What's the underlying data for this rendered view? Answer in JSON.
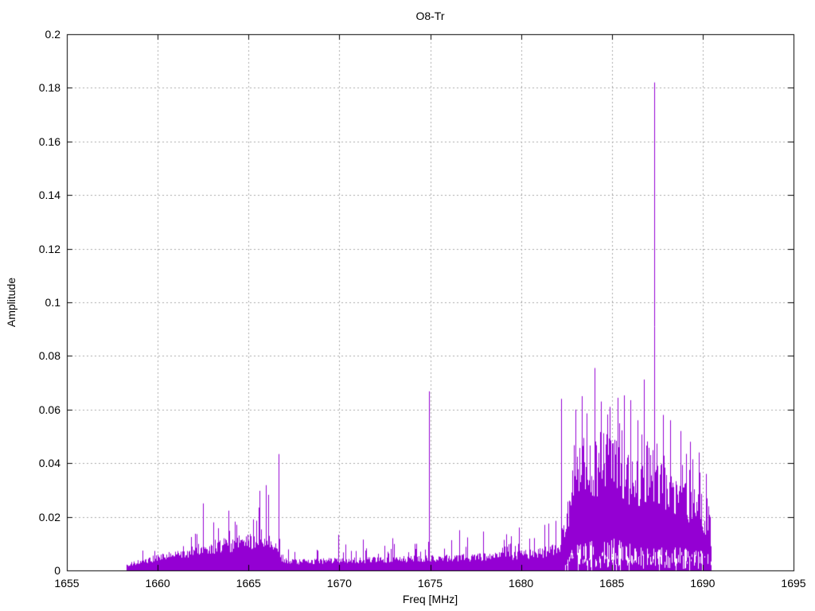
{
  "page": {
    "background": "#ffffff",
    "text_color": "#000000"
  },
  "chart_data": {
    "type": "line",
    "title": "O8-Tr",
    "xlabel": "Freq [MHz]",
    "ylabel": "Amplitude",
    "xlim": [
      1655,
      1695
    ],
    "ylim": [
      0,
      0.2
    ],
    "grid": true,
    "legend": "none",
    "series_name": "spectrum",
    "series_color": "#9400d3",
    "grid_color": "#a8a8a8",
    "axis_color": "#000000",
    "x_ticks": [
      {
        "v": 1655,
        "label": "1655"
      },
      {
        "v": 1660,
        "label": "1660"
      },
      {
        "v": 1665,
        "label": "1665"
      },
      {
        "v": 1670,
        "label": "1670"
      },
      {
        "v": 1675,
        "label": "1675"
      },
      {
        "v": 1680,
        "label": "1680"
      },
      {
        "v": 1685,
        "label": "1685"
      },
      {
        "v": 1690,
        "label": "1690"
      },
      {
        "v": 1695,
        "label": "1695"
      }
    ],
    "y_ticks": [
      {
        "v": 0,
        "label": "0"
      },
      {
        "v": 0.02,
        "label": "0.02"
      },
      {
        "v": 0.04,
        "label": "0.04"
      },
      {
        "v": 0.06,
        "label": "0.06"
      },
      {
        "v": 0.08,
        "label": "0.08"
      },
      {
        "v": 0.1,
        "label": "0.1"
      },
      {
        "v": 0.12,
        "label": "0.12"
      },
      {
        "v": 0.14,
        "label": "0.14"
      },
      {
        "v": 0.16,
        "label": "0.16"
      },
      {
        "v": 0.18,
        "label": "0.18"
      },
      {
        "v": 0.2,
        "label": "0.2"
      }
    ],
    "data_range": [
      1658.3,
      1690.45
    ],
    "envelope": {
      "dense_top": [
        [
          1658.3,
          0.0025
        ],
        [
          1659,
          0.004
        ],
        [
          1660,
          0.006
        ],
        [
          1661,
          0.007
        ],
        [
          1662,
          0.009
        ],
        [
          1663,
          0.011
        ],
        [
          1664,
          0.012
        ],
        [
          1665,
          0.013
        ],
        [
          1665.8,
          0.015
        ],
        [
          1666.3,
          0.013
        ],
        [
          1666.8,
          0.006
        ],
        [
          1667.3,
          0.004
        ],
        [
          1670,
          0.0045
        ],
        [
          1673,
          0.005
        ],
        [
          1675,
          0.0055
        ],
        [
          1677,
          0.006
        ],
        [
          1679,
          0.0065
        ],
        [
          1681,
          0.008
        ],
        [
          1682,
          0.01
        ],
        [
          1682.4,
          0.018
        ],
        [
          1682.7,
          0.035
        ],
        [
          1683.2,
          0.046
        ],
        [
          1684,
          0.05
        ],
        [
          1685,
          0.048
        ],
        [
          1686,
          0.044
        ],
        [
          1687,
          0.042
        ],
        [
          1687.6,
          0.04
        ],
        [
          1688.3,
          0.036
        ],
        [
          1689,
          0.032
        ],
        [
          1689.7,
          0.028
        ],
        [
          1690.1,
          0.024
        ],
        [
          1690.45,
          0.016
        ]
      ],
      "peak_top": [
        [
          1658.3,
          0.005
        ],
        [
          1659,
          0.009
        ],
        [
          1660,
          0.0115
        ],
        [
          1661,
          0.012
        ],
        [
          1662,
          0.014
        ],
        [
          1663,
          0.018
        ],
        [
          1663.9,
          0.022
        ],
        [
          1664.5,
          0.018
        ],
        [
          1665.2,
          0.02
        ],
        [
          1665.9,
          0.03
        ],
        [
          1666.3,
          0.026
        ],
        [
          1666.8,
          0.012
        ],
        [
          1667.3,
          0.009
        ],
        [
          1670,
          0.01
        ],
        [
          1672,
          0.01
        ],
        [
          1674,
          0.011
        ],
        [
          1675.5,
          0.012
        ],
        [
          1677,
          0.013
        ],
        [
          1678.5,
          0.013
        ],
        [
          1680,
          0.015
        ],
        [
          1681,
          0.016
        ],
        [
          1681.9,
          0.02
        ],
        [
          1682.4,
          0.03
        ],
        [
          1682.7,
          0.05
        ],
        [
          1683.2,
          0.058
        ],
        [
          1684,
          0.062
        ],
        [
          1685,
          0.06
        ],
        [
          1686,
          0.056
        ],
        [
          1687,
          0.054
        ],
        [
          1687.6,
          0.052
        ],
        [
          1688.3,
          0.048
        ],
        [
          1689,
          0.044
        ],
        [
          1689.7,
          0.04
        ],
        [
          1690.1,
          0.034
        ],
        [
          1690.45,
          0.022
        ]
      ],
      "mass_bottom": [
        [
          1658.3,
          0
        ],
        [
          1682.3,
          0
        ],
        [
          1682.6,
          0.004
        ],
        [
          1683.2,
          0.006
        ],
        [
          1685,
          0.007
        ],
        [
          1687,
          0.006
        ],
        [
          1689,
          0.005
        ],
        [
          1690.2,
          0.004
        ],
        [
          1690.45,
          0.003
        ]
      ]
    },
    "spikes": [
      [
        1662.5,
        0.025
      ],
      [
        1663.9,
        0.0223
      ],
      [
        1665.6,
        0.0297
      ],
      [
        1665.95,
        0.0318
      ],
      [
        1666.1,
        0.0282
      ],
      [
        1666.65,
        0.0434
      ],
      [
        1669.95,
        0.0133
      ],
      [
        1671.3,
        0.0115
      ],
      [
        1672.9,
        0.012
      ],
      [
        1674.95,
        0.0668
      ],
      [
        1676.6,
        0.015
      ],
      [
        1677.9,
        0.0145
      ],
      [
        1679.2,
        0.0135
      ],
      [
        1679.9,
        0.016
      ],
      [
        1681.3,
        0.017
      ],
      [
        1681.9,
        0.0185
      ],
      [
        1682.2,
        0.064
      ],
      [
        1683.0,
        0.06
      ],
      [
        1683.35,
        0.065
      ],
      [
        1684.05,
        0.0755
      ],
      [
        1684.4,
        0.063
      ],
      [
        1684.9,
        0.061
      ],
      [
        1685.3,
        0.0644
      ],
      [
        1685.65,
        0.0653
      ],
      [
        1686.0,
        0.0635
      ],
      [
        1686.4,
        0.056
      ],
      [
        1686.75,
        0.0712
      ],
      [
        1687.35,
        0.182
      ],
      [
        1687.8,
        0.058
      ],
      [
        1688.2,
        0.056
      ],
      [
        1688.8,
        0.052
      ],
      [
        1689.3,
        0.048
      ],
      [
        1689.8,
        0.044
      ],
      [
        1690.2,
        0.036
      ]
    ]
  }
}
